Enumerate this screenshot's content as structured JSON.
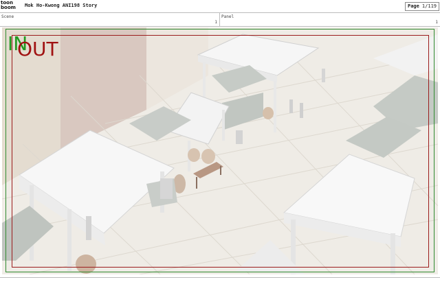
{
  "header": {
    "logo_line1": "toon",
    "logo_line2": "boom",
    "title": "Mok Ho-Kwong ANI198 Story",
    "page_label": "Page",
    "page_value": "1/119"
  },
  "fields": {
    "scene_label": "Scene",
    "scene_value": "1",
    "panel_label": "Panel",
    "panel_value": "1"
  },
  "panel": {
    "in_label": "IN",
    "out_label": "OUT",
    "colors": {
      "in_frame": "#2f8a2f",
      "out_frame": "#9a1b1b",
      "floor": "#efece6",
      "tent": "#f4f4f4",
      "counter": "#c9ccc8"
    }
  }
}
